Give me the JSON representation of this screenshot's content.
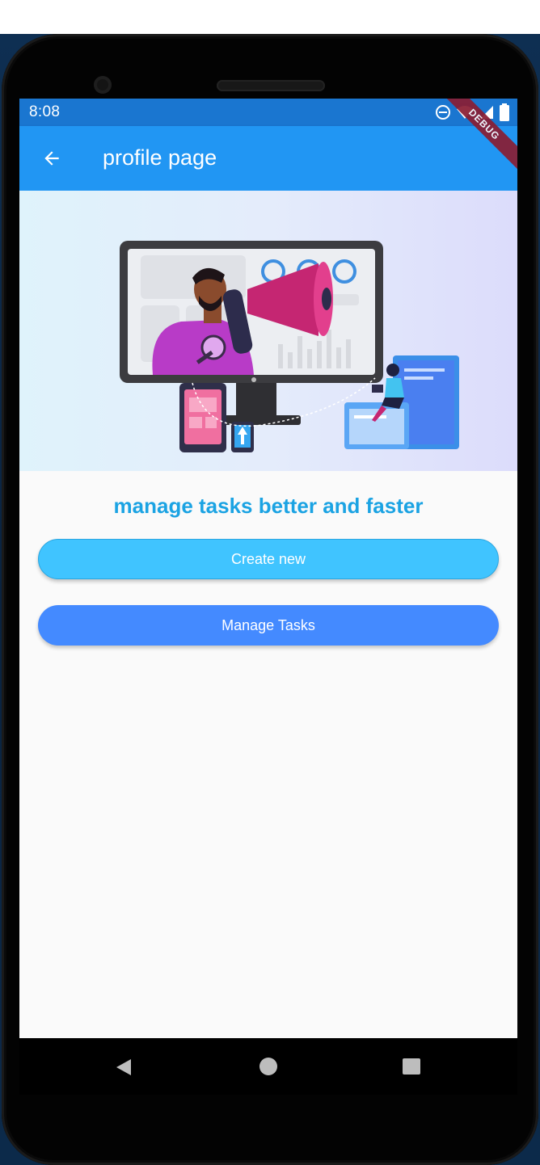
{
  "status_bar": {
    "time": "8:08",
    "icons": [
      "do-not-disturb-icon",
      "wifi-icon",
      "signal-icon",
      "battery-icon"
    ],
    "color": "#1a76d0"
  },
  "debug_banner": "DEBUG",
  "app_bar": {
    "title": "profile page",
    "back_icon": "arrow-back-icon",
    "color": "#2196f3"
  },
  "hero": {
    "illustration": "megaphone-marketing-illustration"
  },
  "tagline": "manage tasks better and faster",
  "buttons": {
    "create_label": "Create new",
    "create_color": "#40c4ff",
    "manage_label": "Manage Tasks",
    "manage_color": "#448aff"
  },
  "nav_bar": {
    "icons": [
      "nav-back-icon",
      "nav-home-icon",
      "nav-recents-icon"
    ]
  }
}
